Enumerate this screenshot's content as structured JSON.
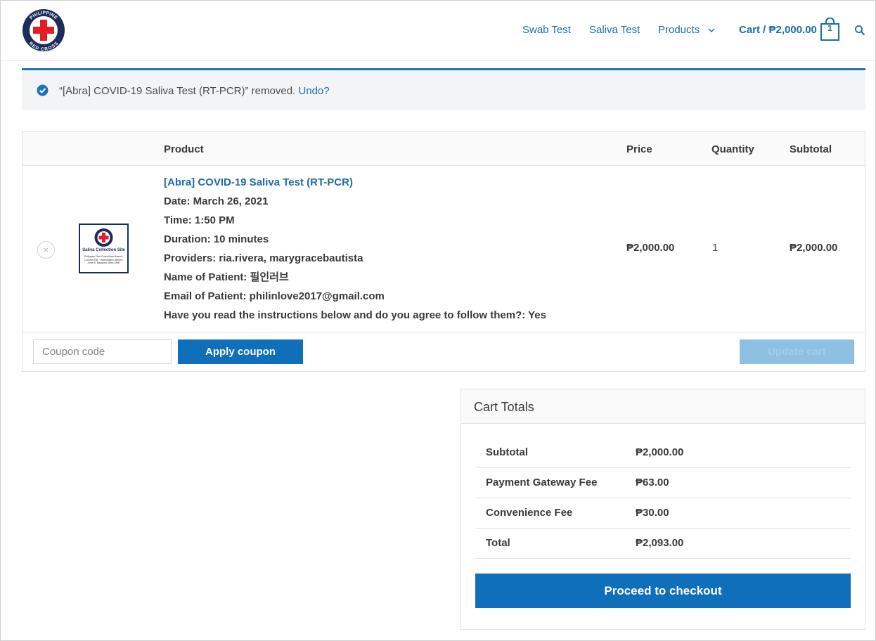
{
  "header": {
    "logo_text": "PHILIPPINE RED CROSS",
    "nav": [
      {
        "label": "Swab Test"
      },
      {
        "label": "Saliva Test"
      },
      {
        "label": "Products"
      }
    ],
    "cart_label": "Cart / ₱2,000.00",
    "cart_count": "1"
  },
  "notice": {
    "message": "“[Abra] COVID-19 Saliva Test (RT-PCR)” removed.",
    "undo_label": "Undo?"
  },
  "cart_table": {
    "headers": {
      "product": "Product",
      "price": "Price",
      "quantity": "Quantity",
      "subtotal": "Subtotal"
    },
    "item": {
      "name": "[Abra] COVID-19 Saliva Test (RT-PCR)",
      "details": [
        "Date: March 26, 2021",
        "Time: 1:50 PM",
        "Duration: 10 minutes",
        "Providers: ria.rivera, marygracebautista",
        "Name of Patient: 필인러브",
        "Email of Patient: philinlove2017@gmail.com",
        "Have you read the instructions below and do you agree to follow them?: Yes"
      ],
      "thumb_title": "Saliva Collection Site",
      "thumb_subtitle": "Philippine Red Cross Abra Branch, Corners Taft · Washington Streets, Zone 6, Bangued, Abra 2800",
      "price": "₱2,000.00",
      "quantity": "1",
      "subtotal": "₱2,000.00",
      "remove_symbol": "×"
    },
    "coupon_placeholder": "Coupon code",
    "apply_label": "Apply coupon",
    "update_label": "Update cart"
  },
  "totals": {
    "title": "Cart Totals",
    "rows": [
      {
        "label": "Subtotal",
        "value": "₱2,000.00"
      },
      {
        "label": "Payment Gateway Fee",
        "value": "₱63.00"
      },
      {
        "label": "Convenience Fee",
        "value": "₱30.00"
      },
      {
        "label": "Total",
        "value": "₱2,093.00"
      }
    ],
    "checkout_label": "Proceed to checkout"
  },
  "colors": {
    "accent": "#0f6fba",
    "link": "#1c6ea4",
    "red_cross": "#e21f26",
    "logo_navy": "#1d2d5a"
  }
}
